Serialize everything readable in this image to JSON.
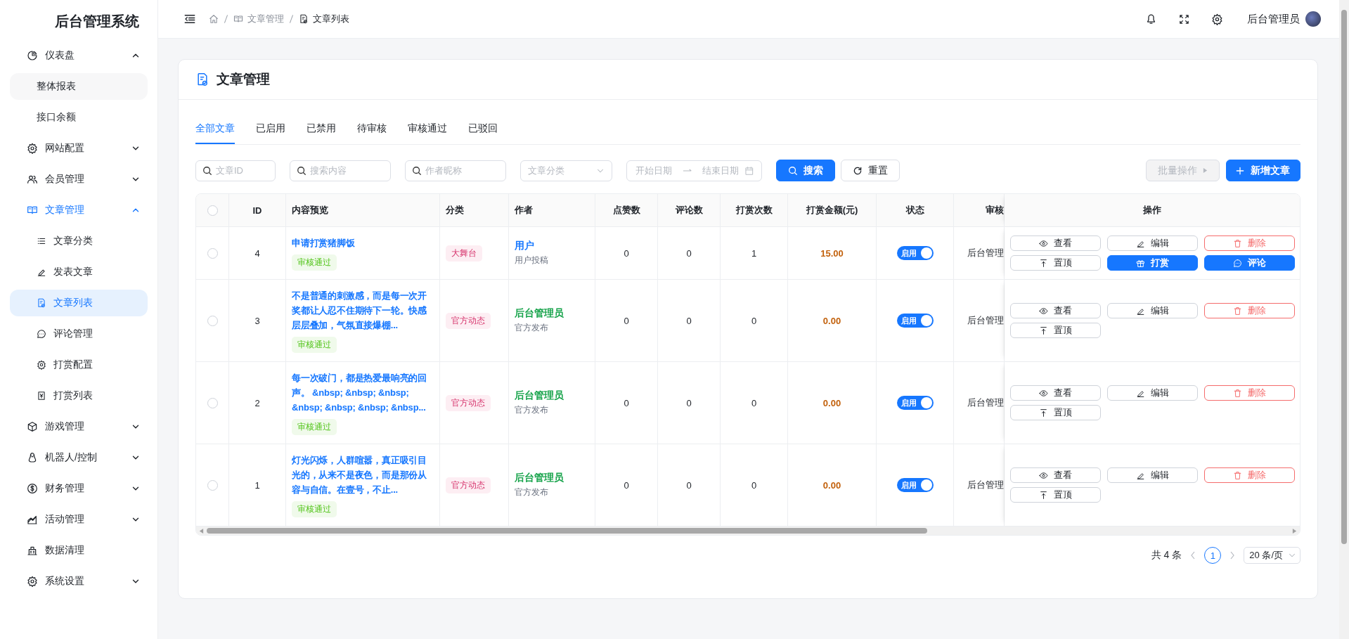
{
  "sidebar": {
    "title": "后台管理系统",
    "items": [
      {
        "label": "仪表盘",
        "kind": "group",
        "expanded": true,
        "active": false,
        "children": [
          {
            "label": "整体报表",
            "hovered": true,
            "selected": false
          },
          {
            "label": "接口余额",
            "hovered": false,
            "selected": false
          }
        ]
      },
      {
        "label": "网站配置",
        "kind": "group",
        "expanded": false,
        "active": false
      },
      {
        "label": "会员管理",
        "kind": "group",
        "expanded": false,
        "active": false
      },
      {
        "label": "文章管理",
        "kind": "group",
        "expanded": true,
        "active": true,
        "children": [
          {
            "label": "文章分类",
            "hovered": false,
            "selected": false
          },
          {
            "label": "发表文章",
            "hovered": false,
            "selected": false
          },
          {
            "label": "文章列表",
            "hovered": false,
            "selected": true
          },
          {
            "label": "评论管理",
            "hovered": false,
            "selected": false
          },
          {
            "label": "打赏配置",
            "hovered": false,
            "selected": false
          },
          {
            "label": "打赏列表",
            "hovered": false,
            "selected": false
          }
        ]
      },
      {
        "label": "游戏管理",
        "kind": "group",
        "expanded": false,
        "active": false
      },
      {
        "label": "机器人/控制",
        "kind": "group",
        "expanded": false,
        "active": false
      },
      {
        "label": "财务管理",
        "kind": "group",
        "expanded": false,
        "active": false
      },
      {
        "label": "活动管理",
        "kind": "group",
        "expanded": false,
        "active": false
      },
      {
        "label": "数据清理",
        "kind": "link",
        "active": false
      },
      {
        "label": "系统设置",
        "kind": "group",
        "expanded": false,
        "active": false
      }
    ]
  },
  "header": {
    "breadcrumb": [
      "文章管理",
      "文章列表"
    ],
    "user": "后台管理员"
  },
  "card": {
    "title": "文章管理",
    "tabs": [
      {
        "label": "全部文章",
        "selected": true
      },
      {
        "label": "已启用",
        "selected": false
      },
      {
        "label": "已禁用",
        "selected": false
      },
      {
        "label": "待审核",
        "selected": false
      },
      {
        "label": "审核通过",
        "selected": false
      },
      {
        "label": "已驳回",
        "selected": false
      }
    ],
    "filters": {
      "id": {
        "placeholder": "文章ID"
      },
      "content": {
        "placeholder": "搜索内容"
      },
      "author": {
        "placeholder": "作者昵称"
      },
      "category": {
        "placeholder": "文章分类"
      },
      "start_date": {
        "placeholder": "开始日期"
      },
      "end_date": {
        "placeholder": "结束日期"
      }
    },
    "buttons": [
      {
        "label": "搜索",
        "kind": "search",
        "disabled": false
      },
      {
        "label": "重置",
        "kind": "reset",
        "disabled": false
      },
      {
        "label": "批量操作",
        "kind": "batch",
        "disabled": true
      },
      {
        "label": "新增文章",
        "kind": "add",
        "disabled": false
      }
    ],
    "table": {
      "all_checked": false,
      "columns": [
        "ID",
        "内容预览",
        "分类",
        "作者",
        "点赞数",
        "评论数",
        "打赏次数",
        "打赏金额(元)",
        "状态",
        "审核",
        "操作"
      ],
      "rows": [
        {
          "checked": false,
          "id": "4",
          "preview": "申请打赏猪脚饭",
          "review": "审核通过",
          "category": "大舞台",
          "author": {
            "name": "用户",
            "note": "用户投稿",
            "color": "#1677ff"
          },
          "likes": "0",
          "comments": "0",
          "tips": "1",
          "amount": "15.00",
          "status": {
            "label": "启用",
            "on": true
          },
          "reviewer": "后台管理",
          "actions": [
            {
              "label": "查看",
              "kind": "view"
            },
            {
              "label": "编辑",
              "kind": "edit"
            },
            {
              "label": "删除",
              "kind": "delete"
            },
            {
              "label": "置顶",
              "kind": "pin"
            },
            {
              "label": "打赏",
              "kind": "tip"
            },
            {
              "label": "评论",
              "kind": "comment"
            }
          ]
        },
        {
          "checked": false,
          "id": "3",
          "preview": "不是普通的刺激感，而是每一次开奖都让人忍不住期待下一轮。快感层层叠加，气氛直接爆棚...",
          "review": "审核通过",
          "category": "官方动态",
          "author": {
            "name": "后台管理员",
            "note": "官方发布",
            "color": "#16a34a"
          },
          "likes": "0",
          "comments": "0",
          "tips": "0",
          "amount": "0.00",
          "status": {
            "label": "启用",
            "on": true
          },
          "reviewer": "后台管理",
          "actions": [
            {
              "label": "查看",
              "kind": "view"
            },
            {
              "label": "编辑",
              "kind": "edit"
            },
            {
              "label": "删除",
              "kind": "delete"
            },
            {
              "label": "置顶",
              "kind": "pin"
            }
          ]
        },
        {
          "checked": false,
          "id": "2",
          "preview": "每一次破门，都是热爱最响亮的回声。 &nbsp; &nbsp; &nbsp; &nbsp; &nbsp; &nbsp; &nbsp...",
          "review": "审核通过",
          "category": "官方动态",
          "author": {
            "name": "后台管理员",
            "note": "官方发布",
            "color": "#16a34a"
          },
          "likes": "0",
          "comments": "0",
          "tips": "0",
          "amount": "0.00",
          "status": {
            "label": "启用",
            "on": true
          },
          "reviewer": "后台管理",
          "actions": [
            {
              "label": "查看",
              "kind": "view"
            },
            {
              "label": "编辑",
              "kind": "edit"
            },
            {
              "label": "删除",
              "kind": "delete"
            },
            {
              "label": "置顶",
              "kind": "pin"
            }
          ]
        },
        {
          "checked": false,
          "id": "1",
          "preview": "灯光闪烁，人群喧嚣，真正吸引目光的，从来不是夜色，而是那份从容与自信。在壹号，不止...",
          "review": "审核通过",
          "category": "官方动态",
          "author": {
            "name": "后台管理员",
            "note": "官方发布",
            "color": "#16a34a"
          },
          "likes": "0",
          "comments": "0",
          "tips": "0",
          "amount": "0.00",
          "status": {
            "label": "启用",
            "on": true
          },
          "reviewer": "后台管理",
          "actions": [
            {
              "label": "查看",
              "kind": "view"
            },
            {
              "label": "编辑",
              "kind": "edit"
            },
            {
              "label": "删除",
              "kind": "delete"
            },
            {
              "label": "置顶",
              "kind": "pin"
            }
          ]
        }
      ]
    },
    "pagination": {
      "total": "共 4 条",
      "pages": [
        {
          "label": "1",
          "selected": true
        }
      ],
      "page_size": "20 条/页"
    }
  }
}
